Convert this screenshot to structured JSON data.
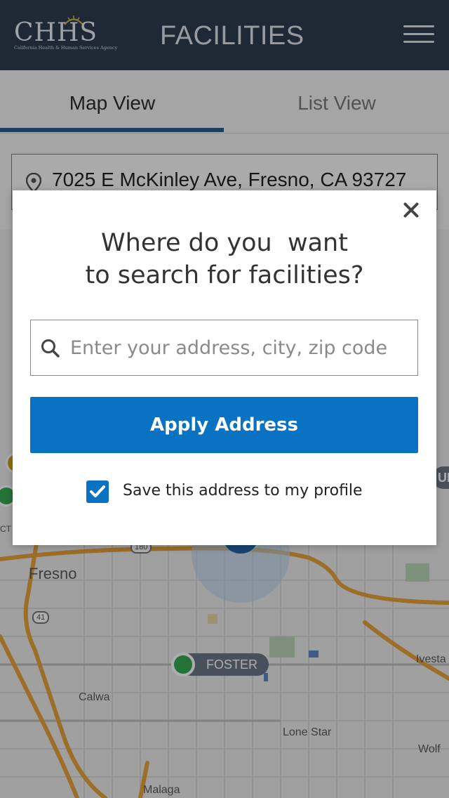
{
  "header": {
    "logo_text": "CHHS",
    "logo_subtitle": "California Health & Human Services Agency",
    "title": "FACILITIES",
    "menu_icon": "hamburger-menu-icon"
  },
  "tabs": [
    {
      "label": "Map View",
      "active": true
    },
    {
      "label": "List View",
      "active": false
    }
  ],
  "current_address": {
    "icon": "location-pin-icon",
    "value": "7025 E McKinley Ave, Fresno, CA 93727"
  },
  "map": {
    "places": [
      "Fresno",
      "Calwa",
      "Lone Star",
      "Wolf",
      "Malaga",
      "Ivesta"
    ],
    "partial_label": "CT",
    "highways": [
      "180",
      "41"
    ],
    "markers": [
      {
        "label": "FOSTER",
        "status_color": "#36a852"
      },
      {
        "label": "UE",
        "status_color": "#6a7887"
      }
    ]
  },
  "modal": {
    "close_icon": "close-icon",
    "title_line1": "Where do you  want",
    "title_line2": "to search for facilities?",
    "search": {
      "icon": "search-icon",
      "value": "",
      "placeholder": "Enter your address, city, zip code"
    },
    "apply_label": "Apply Address",
    "save_checkbox": {
      "checked": true,
      "label": "Save this address to my profile"
    }
  },
  "colors": {
    "header_bg": "#2f3d4f",
    "accent_blue": "#0a72c2",
    "tab_underline": "#2b5c93",
    "marker_green": "#36a852",
    "marker_yellow": "#d6a31a",
    "road_orange": "#e8a23a"
  }
}
